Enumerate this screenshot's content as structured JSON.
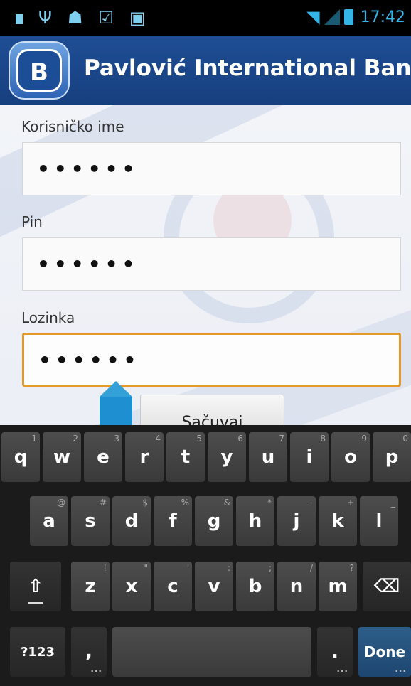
{
  "status_bar": {
    "time": "17:42",
    "left_icons": [
      "notification-icon",
      "usb-icon",
      "android-debug-icon",
      "shopping-bag-check-icon",
      "shopping-bag-icon"
    ],
    "right_icons": [
      "wifi-icon",
      "signal-icon",
      "battery-charging-icon"
    ]
  },
  "action_bar": {
    "title": "Pavlović International Bank",
    "logo_text": "B"
  },
  "form": {
    "username_label": "Korisničko ime",
    "username_value": "••••••",
    "pin_label": "Pin",
    "pin_value": "••••••",
    "password_label": "Lozinka",
    "password_value": "••••••",
    "save_label": "Sačuvaj"
  },
  "keyboard": {
    "row1": [
      {
        "key": "q",
        "hint": "1"
      },
      {
        "key": "w",
        "hint": "2"
      },
      {
        "key": "e",
        "hint": "3"
      },
      {
        "key": "r",
        "hint": "4"
      },
      {
        "key": "t",
        "hint": "5"
      },
      {
        "key": "y",
        "hint": "6"
      },
      {
        "key": "u",
        "hint": "7"
      },
      {
        "key": "i",
        "hint": "8"
      },
      {
        "key": "o",
        "hint": "9"
      },
      {
        "key": "p",
        "hint": "0"
      }
    ],
    "row2": [
      {
        "key": "a",
        "hint": "@"
      },
      {
        "key": "s",
        "hint": "#"
      },
      {
        "key": "d",
        "hint": "$"
      },
      {
        "key": "f",
        "hint": "%"
      },
      {
        "key": "g",
        "hint": "&"
      },
      {
        "key": "h",
        "hint": "*"
      },
      {
        "key": "j",
        "hint": "-"
      },
      {
        "key": "k",
        "hint": "+"
      },
      {
        "key": "l",
        "hint": "_"
      }
    ],
    "row3": [
      {
        "key": "z",
        "hint": "!"
      },
      {
        "key": "x",
        "hint": "\""
      },
      {
        "key": "c",
        "hint": "'"
      },
      {
        "key": "v",
        "hint": ":"
      },
      {
        "key": "b",
        "hint": ";"
      },
      {
        "key": "n",
        "hint": "/"
      },
      {
        "key": "m",
        "hint": "?"
      }
    ],
    "shift": "⇧",
    "backspace": "⌫",
    "symbols": "?123",
    "comma": ",",
    "period": ".",
    "done": "Done"
  }
}
